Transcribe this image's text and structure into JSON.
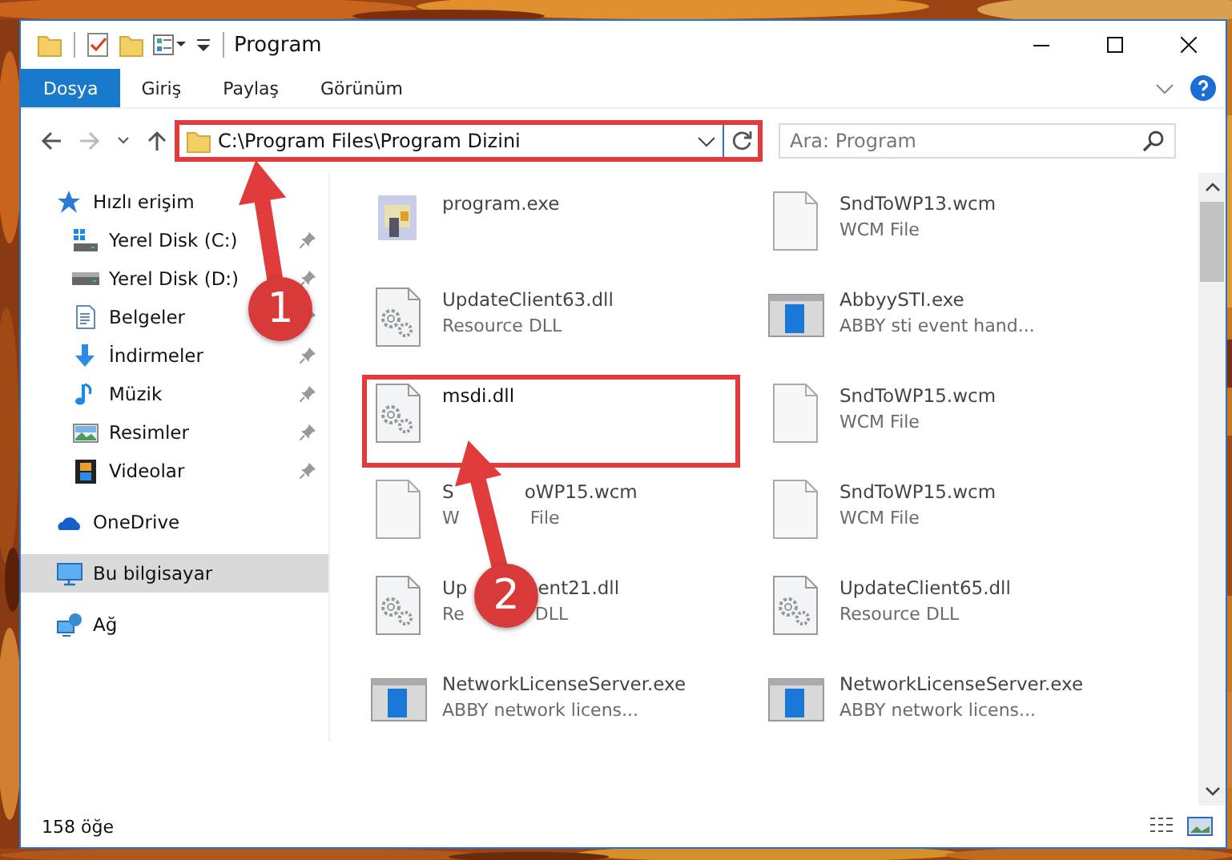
{
  "window": {
    "title": "Program"
  },
  "ribbon_tabs": [
    {
      "label": "Dosya",
      "selected": true
    },
    {
      "label": "Giriş",
      "selected": false
    },
    {
      "label": "Paylaş",
      "selected": false
    },
    {
      "label": "Görünüm",
      "selected": false
    }
  ],
  "address_bar": {
    "path": "C:\\Program Files\\Program Dizini",
    "highlighted": true
  },
  "search": {
    "placeholder": "Ara: Program"
  },
  "sidebar": {
    "items": [
      {
        "label": "Hızlı erişim",
        "selected": false,
        "children": [
          {
            "label": "Yerel Disk (C:)",
            "pinned": true,
            "selected": false
          },
          {
            "label": "Yerel Disk (D:)",
            "pinned": true,
            "selected": false
          },
          {
            "label": "Belgeler",
            "pinned": true,
            "selected": false
          },
          {
            "label": "İndirmeler",
            "pinned": true,
            "selected": false
          },
          {
            "label": "Müzik",
            "pinned": true,
            "selected": false
          },
          {
            "label": "Resimler",
            "pinned": true,
            "selected": false
          },
          {
            "label": "Videolar",
            "pinned": true,
            "selected": false
          }
        ]
      },
      {
        "label": "OneDrive",
        "selected": false
      },
      {
        "label": "Bu bilgisayar",
        "selected": true
      },
      {
        "label": "Ağ",
        "selected": false
      }
    ]
  },
  "files": [
    {
      "kind": "installer",
      "name": "program.exe",
      "highlighted": false
    },
    {
      "kind": "document",
      "name": "SndToWP13.wcm",
      "type": "WCM File",
      "highlighted": false
    },
    {
      "kind": "dll",
      "name": "UpdateClient63.dll",
      "type": "Resource DLL",
      "highlighted": false
    },
    {
      "kind": "window",
      "name": "AbbyySTI.exe",
      "type": "ABBY sti event hand...",
      "highlighted": false
    },
    {
      "kind": "dll",
      "name": "msdi.dll",
      "highlighted": true
    },
    {
      "kind": "document",
      "name": "SndToWP15.wcm",
      "type": "WCM File",
      "highlighted": false
    },
    {
      "kind": "document",
      "name_parts": [
        "S",
        "oWP15.wcm"
      ],
      "type_parts": [
        "W",
        "File"
      ],
      "highlighted": false
    },
    {
      "kind": "document",
      "name": "SndToWP15.wcm",
      "type": "WCM File",
      "highlighted": false
    },
    {
      "kind": "dll",
      "name_parts": [
        "Up",
        "ent21.dll"
      ],
      "type_parts": [
        "Re",
        "DLL"
      ],
      "highlighted": false
    },
    {
      "kind": "dll",
      "name": "UpdateClient65.dll",
      "type": "Resource DLL",
      "highlighted": false
    },
    {
      "kind": "window",
      "name": "NetworkLicenseServer.exe",
      "type": "ABBY network licens...",
      "highlighted": false
    },
    {
      "kind": "window",
      "name": "NetworkLicenseServer.exe",
      "type": "ABBY network licens...",
      "highlighted": false
    }
  ],
  "status_bar": {
    "item_count": "158 öğe"
  },
  "annotations": [
    {
      "number": "1"
    },
    {
      "number": "2"
    }
  ]
}
